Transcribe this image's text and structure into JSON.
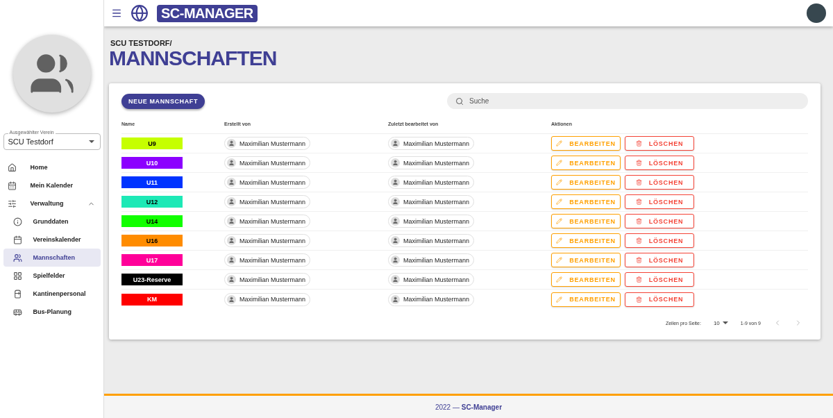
{
  "app": {
    "title": "SC-MANAGER"
  },
  "sidebar": {
    "club_select": {
      "label": "Ausgewählter Verein",
      "value": "SCU Testdorf"
    },
    "items": [
      {
        "label": "Home",
        "selected": false
      },
      {
        "label": "Mein Kalender",
        "selected": false
      },
      {
        "label": "Verwaltung",
        "selected": false,
        "expanded": true,
        "children": [
          {
            "label": "Grunddaten",
            "selected": false
          },
          {
            "label": "Vereinskalender",
            "selected": false
          },
          {
            "label": "Mannschaften",
            "selected": true
          },
          {
            "label": "Spielfelder",
            "selected": false
          },
          {
            "label": "Kantinenpersonal",
            "selected": false
          },
          {
            "label": "Bus-Planung",
            "selected": false
          }
        ]
      }
    ]
  },
  "page": {
    "breadcrumb": "SCU TESTDORF/",
    "title": "MANNSCHAFTEN"
  },
  "toolbar": {
    "new_button": "NEUE MANNSCHAFT",
    "search": {
      "placeholder": "Suche"
    }
  },
  "table": {
    "columns": [
      "Name",
      "Erstellt von",
      "Zuletzt bearbeitet von",
      "Aktionen"
    ],
    "rows": [
      {
        "name": "U9",
        "color": "#c6ff00",
        "created_by": "Maximilian Mustermann",
        "edited_by": "Maximilian Mustermann",
        "edit": "BEARBEITEN",
        "delete": "LÖSCHEN"
      },
      {
        "name": "U10",
        "color": "#8c00ff",
        "created_by": "Maximilian Mustermann",
        "edited_by": "Maximilian Mustermann",
        "edit": "BEARBEITEN",
        "delete": "LÖSCHEN"
      },
      {
        "name": "U11",
        "color": "#0033ff",
        "created_by": "Maximilian Mustermann",
        "edited_by": "Maximilian Mustermann",
        "edit": "BEARBEITEN",
        "delete": "LÖSCHEN"
      },
      {
        "name": "U12",
        "color": "#1de9b6",
        "created_by": "Maximilian Mustermann",
        "edited_by": "Maximilian Mustermann",
        "edit": "BEARBEITEN",
        "delete": "LÖSCHEN"
      },
      {
        "name": "U14",
        "color": "#11ff00",
        "created_by": "Maximilian Mustermann",
        "edited_by": "Maximilian Mustermann",
        "edit": "BEARBEITEN",
        "delete": "LÖSCHEN"
      },
      {
        "name": "U16",
        "color": "#ff8c00",
        "created_by": "Maximilian Mustermann",
        "edited_by": "Maximilian Mustermann",
        "edit": "BEARBEITEN",
        "delete": "LÖSCHEN"
      },
      {
        "name": "U17",
        "color": "#ff0099",
        "created_by": "Maximilian Mustermann",
        "edited_by": "Maximilian Mustermann",
        "edit": "BEARBEITEN",
        "delete": "LÖSCHEN"
      },
      {
        "name": "U23-Reserve",
        "color": "#000000",
        "created_by": "Maximilian Mustermann",
        "edited_by": "Maximilian Mustermann",
        "edit": "BEARBEITEN",
        "delete": "LÖSCHEN"
      },
      {
        "name": "KM",
        "color": "#ff0000",
        "created_by": "Maximilian Mustermann",
        "edited_by": "Maximilian Mustermann",
        "edit": "BEARBEITEN",
        "delete": "LÖSCHEN"
      }
    ]
  },
  "pagination": {
    "rows_label": "Zeilen pro Seite:",
    "rows_value": "10",
    "range": "1-9 von 9"
  },
  "footer": {
    "text": "2022 — **SC-Manager**"
  }
}
